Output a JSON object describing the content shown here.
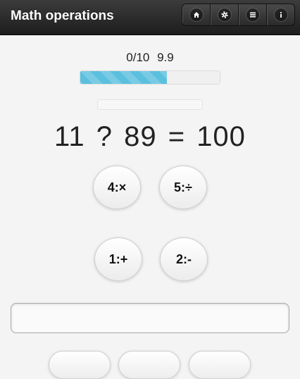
{
  "header": {
    "title": "Math operations",
    "nav": [
      {
        "name": "nav-home-button",
        "icon": "home-icon"
      },
      {
        "name": "nav-settings-button",
        "icon": "gear-icon"
      },
      {
        "name": "nav-menu-button",
        "icon": "list-icon"
      },
      {
        "name": "nav-info-button",
        "icon": "info-icon"
      }
    ]
  },
  "status": {
    "score": "0/10",
    "timer": "9.9",
    "progress_fraction": 0.62
  },
  "equation": {
    "left": "11",
    "operator": "?",
    "right": "89",
    "equals": "=",
    "result": "100"
  },
  "operators": [
    {
      "label": "4:×"
    },
    {
      "label": "5:÷"
    },
    {
      "label": "1:+"
    },
    {
      "label": "2:-"
    }
  ],
  "answer": {
    "value": "",
    "placeholder": ""
  },
  "colors": {
    "progress": "#5bc0de",
    "header": "#2a2a2a"
  }
}
